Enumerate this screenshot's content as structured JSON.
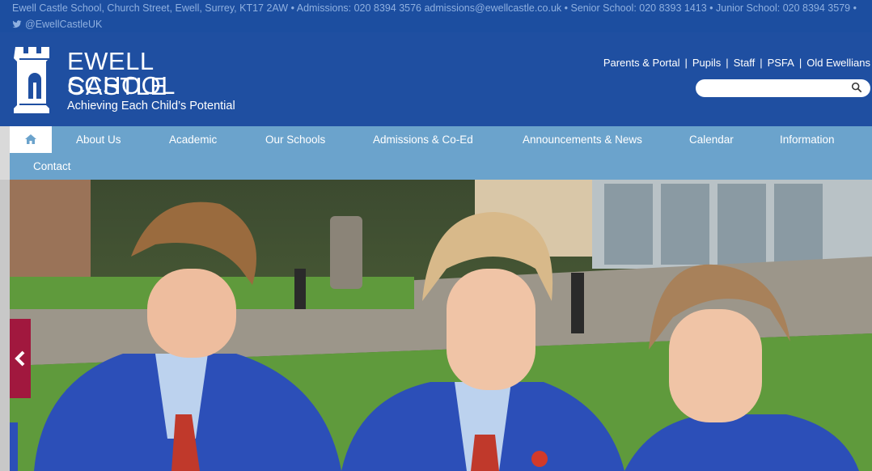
{
  "topbar": {
    "contact_line": "Ewell Castle School, Church Street, Ewell, Surrey, KT17 2AW • Admissions: 020 8394 3576 admissions@ewellcastle.co.uk • Senior School: 020 8393 1413 • Junior School: 020 8394 3579 •",
    "twitter_handle": "@EwellCastleUK",
    "twitter_icon": "twitter-bird-icon"
  },
  "logo": {
    "name_line1": "EWELL CASTLE",
    "name_line2": "SCHOOL",
    "tagline": "Achieving Each Child’s Potential",
    "icon": "castle-tower-icon"
  },
  "toplinks": [
    "Parents & Portal",
    "Pupils",
    "Staff",
    "PSFA",
    "Old Ewellians"
  ],
  "search": {
    "placeholder": "",
    "icon": "search-icon"
  },
  "nav": {
    "home_icon": "home-icon",
    "items": [
      "About Us",
      "Academic",
      "Our Schools",
      "Admissions & Co-Ed",
      "Announcements & News",
      "Calendar",
      "Information",
      "Contact"
    ]
  },
  "hero": {
    "description_icon": "hero-photo",
    "prev_icon": "chevron-left-icon"
  },
  "colors": {
    "header_blue": "#1f4fa1",
    "nav_blue": "#6ba3cc",
    "accent_red": "#a1183e"
  }
}
